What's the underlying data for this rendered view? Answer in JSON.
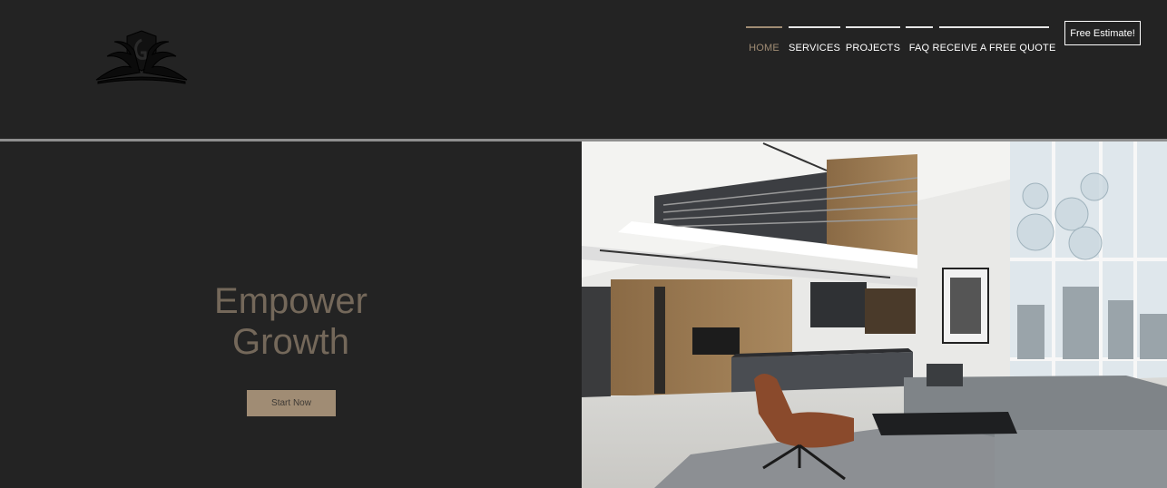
{
  "header": {
    "nav": [
      {
        "label": "HOME",
        "active": true
      },
      {
        "label": "SERVICES",
        "active": false
      },
      {
        "label": "PROJECTS",
        "active": false
      },
      {
        "label": "FAQ",
        "active": false
      },
      {
        "label": "RECEIVE A FREE QUOTE",
        "active": false
      }
    ],
    "cta_label": "Free Estimate!"
  },
  "hero": {
    "title_line1": "Empower",
    "title_line2": "Growth",
    "button_label": "Start Now"
  },
  "colors": {
    "background": "#232323",
    "accent": "#a08c74",
    "title": "#74685a",
    "nav_text": "#ffffff"
  },
  "icons": {
    "logo": "ornamental-shield-logo"
  }
}
